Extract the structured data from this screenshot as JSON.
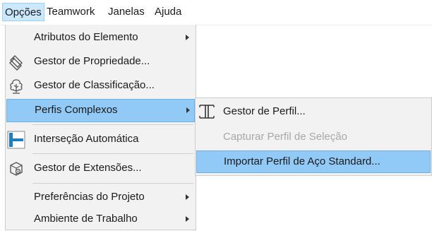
{
  "menubar": {
    "items": [
      {
        "label": "Opções"
      },
      {
        "label": "Teamwork"
      },
      {
        "label": "Janelas"
      },
      {
        "label": "Ajuda"
      }
    ]
  },
  "options_menu": {
    "items": [
      {
        "label": "Atributos do Elemento"
      },
      {
        "label": "Gestor de Propriedade...",
        "icon": "property-manager-icon"
      },
      {
        "label": "Gestor de Classificação...",
        "icon": "classification-manager-icon"
      },
      {
        "label": "Perfis Complexos"
      },
      {
        "label": "Interseção Automática",
        "icon": "auto-intersection-icon"
      },
      {
        "label": "Gestor de Extensões...",
        "icon": "extension-manager-icon"
      },
      {
        "label": "Preferências do Projeto"
      },
      {
        "label": "Ambiente de Trabalho"
      }
    ]
  },
  "submenu": {
    "items": [
      {
        "label": "Gestor de Perfil...",
        "icon": "profile-manager-icon"
      },
      {
        "label": "Capturar Perfil de Seleção"
      },
      {
        "label": "Importar Perfil de Aço Standard..."
      }
    ]
  },
  "colors": {
    "highlight": "#91c9f7",
    "highlight_border": "#6fb0e6",
    "menu_background": "#f2f2f2",
    "disabled_text": "#a8a8a8"
  }
}
